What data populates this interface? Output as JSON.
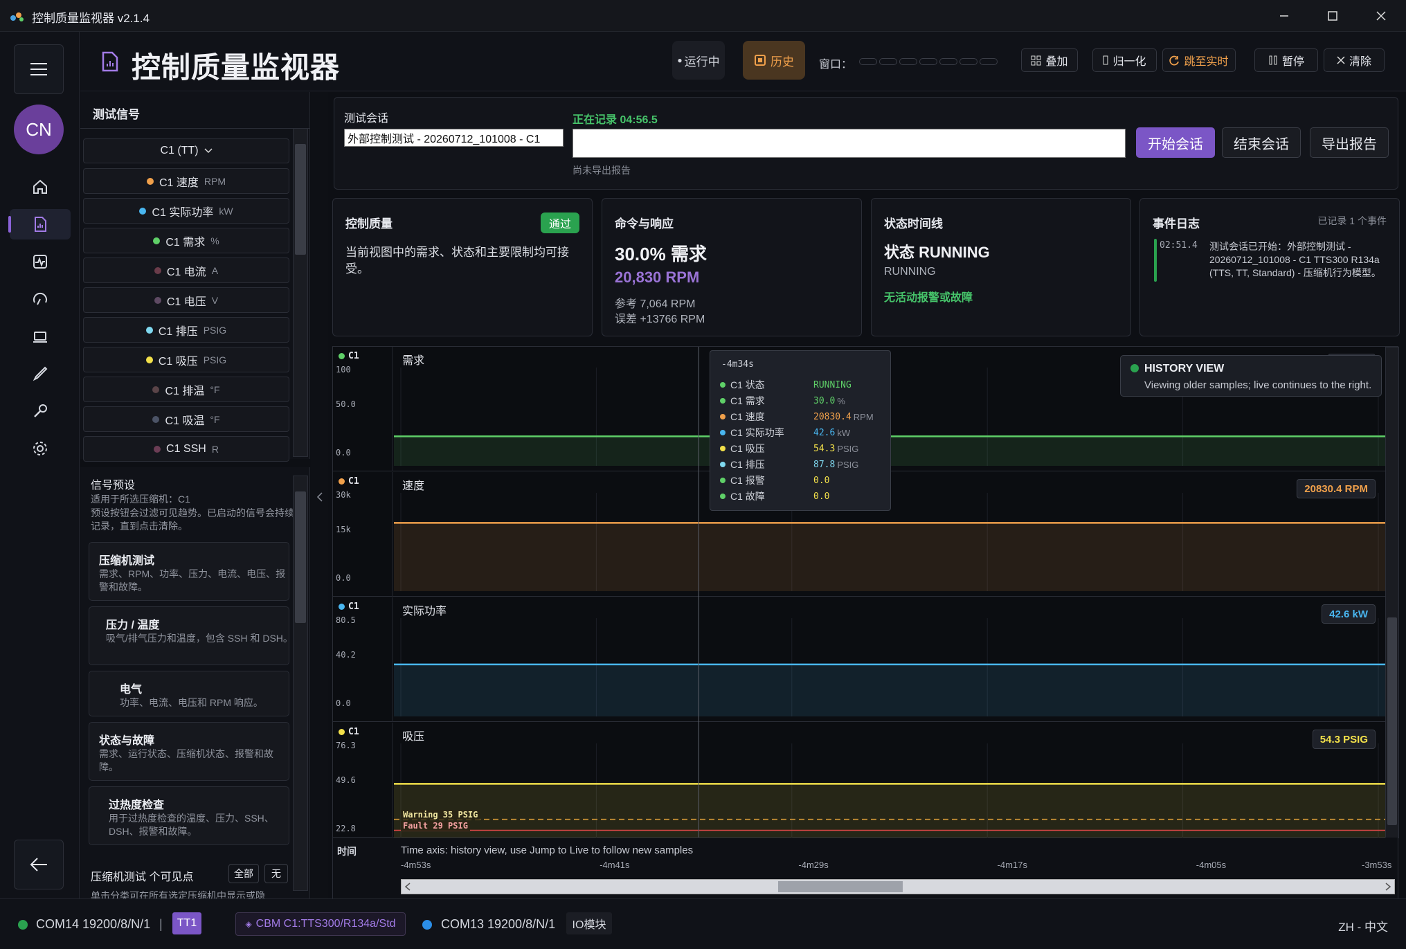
{
  "window": {
    "title": "控制质量监视器 v2.1.4"
  },
  "header": {
    "title": "控制质量监视器",
    "running_label": "运行中",
    "history_label": "历史",
    "window_label": "窗口：",
    "overlay_label": "叠加",
    "normalize_label": "归一化",
    "jump_live_label": "跳至实时",
    "pause_label": "暂停",
    "clear_label": "清除"
  },
  "rail": {
    "avatar_initials": "CN"
  },
  "signals": {
    "title": "测试信号",
    "group": "C1 (TT)",
    "items": [
      {
        "name": "C1 速度",
        "unit": "RPM",
        "color": "#f0a04b"
      },
      {
        "name": "C1 实际功率",
        "unit": "kW",
        "color": "#49b6f0"
      },
      {
        "name": "C1 需求",
        "unit": "%",
        "color": "#5fd068"
      },
      {
        "name": "C1 电流",
        "unit": "A",
        "color": "#6a3c4a"
      },
      {
        "name": "C1 电压",
        "unit": "V",
        "color": "#5e4a63"
      },
      {
        "name": "C1 排压",
        "unit": "PSIG",
        "color": "#7fd8ef"
      },
      {
        "name": "C1 吸压",
        "unit": "PSIG",
        "color": "#f2e04a"
      },
      {
        "name": "C1 排温",
        "unit": "°F",
        "color": "#5a4448"
      },
      {
        "name": "C1 吸温",
        "unit": "°F",
        "color": "#4b5366"
      },
      {
        "name": "C1 SSH",
        "unit": "R",
        "color": "#6b3d55"
      }
    ]
  },
  "presets": {
    "title": "信号预设",
    "applies_to": "适用于所选压缩机：C1",
    "description": "预设按钮会过滤可见趋势。已启动的信号会持续记录，直到点击清除。",
    "cards": [
      {
        "name": "压缩机测试",
        "desc": "需求、RPM、功率、压力、电流、电压、报警和故障。"
      },
      {
        "name": "压力 / 温度",
        "desc": "吸气/排气压力和温度，包含 SSH 和 DSH。"
      },
      {
        "name": "电气",
        "desc": "功率、电流、电压和 RPM 响应。"
      },
      {
        "name": "状态与故障",
        "desc": "需求、运行状态、压缩机状态、报警和故障。"
      },
      {
        "name": "过热度检查",
        "desc": "用于过热度检查的温度、压力、SSH、DSH、报警和故障。"
      }
    ],
    "visible_title": "压缩机测试 个可见点",
    "all_label": "全部",
    "none_label": "无",
    "footer_text": "单击分类可在所有选定压缩机中显示或隐"
  },
  "session": {
    "label": "测试会话",
    "name_value": "外部控制测试 - 20260712_101008 - C1",
    "recording": "正在记录 04:56.5",
    "notes_value": "",
    "export_status": "尚未导出报告",
    "start_label": "开始会话",
    "end_label": "结束会话",
    "export_label": "导出报告"
  },
  "cards": {
    "quality": {
      "title": "控制质量",
      "badge": "通过",
      "text": "当前视图中的需求、状态和主要限制均可接受。"
    },
    "command": {
      "title": "命令与响应",
      "demand": "30.0% 需求",
      "rpm": "20,830 RPM",
      "ref": "参考 7,064 RPM",
      "err": "误差 +13766 RPM"
    },
    "timeline": {
      "title": "状态时间线",
      "state": "状态 RUNNING",
      "sub": "RUNNING",
      "ok": "无活动报警或故障"
    },
    "events": {
      "title": "事件日志",
      "count": "已记录 1 个事件",
      "time": "02:51.4",
      "text": "测试会话已开始：外部控制测试 - 20260712_101008 - C1 TTS300 R134a (TTS, TT, Standard) - 压缩机行为模型。"
    }
  },
  "chart_data": {
    "type": "line",
    "x_range": [
      "-4m53s",
      "-3m53s"
    ],
    "x_ticks": [
      "-4m53s",
      "-4m41s",
      "-4m29s",
      "-4m17s",
      "-4m05s",
      "-3m53s"
    ],
    "cursor_time": "-4m34s",
    "strips": [
      {
        "channel": "C1",
        "title": "需求",
        "color": "#5fd068",
        "ticks": [
          "100",
          "50.0",
          "0.0"
        ],
        "ylim": [
          0,
          100
        ],
        "value": 30.0,
        "tag": "30.0 %"
      },
      {
        "channel": "C1",
        "title": "速度",
        "color": "#f0a04b",
        "ticks": [
          "30k",
          "15k",
          "0.0"
        ],
        "ylim": [
          0,
          30000
        ],
        "value": 20830.4,
        "tag": "20830.4 RPM"
      },
      {
        "channel": "C1",
        "title": "实际功率",
        "color": "#49b6f0",
        "ticks": [
          "80.5",
          "40.2",
          "0.0"
        ],
        "ylim": [
          0,
          80.5
        ],
        "value": 42.6,
        "tag": "42.6 kW"
      },
      {
        "channel": "C1",
        "title": "吸压",
        "color": "#f2e04a",
        "ticks": [
          "76.3",
          "49.6",
          "22.8"
        ],
        "ylim": [
          22.8,
          76.3
        ],
        "value": 54.3,
        "tag": "54.3 PSIG",
        "limits": [
          {
            "label": "Warning 35 PSIG",
            "value": 35,
            "color": "#e0a03a"
          },
          {
            "label": "Fault 29 PSIG",
            "value": 29,
            "color": "#e04848"
          }
        ]
      }
    ],
    "x_axis_label": "时间",
    "x_axis_note": "Time axis: history view, use Jump to Live to follow new samples"
  },
  "tooltip": {
    "time": "-4m34s",
    "rows": [
      {
        "k": "C1 状态",
        "v": "RUNNING",
        "u": "",
        "color": "#5fd068",
        "vcolor": "#5fd068"
      },
      {
        "k": "C1 需求",
        "v": "30.0",
        "u": "%",
        "color": "#5fd068",
        "vcolor": "#5fd068"
      },
      {
        "k": "C1 速度",
        "v": "20830.4",
        "u": "RPM",
        "color": "#f0a04b",
        "vcolor": "#f0a04b"
      },
      {
        "k": "C1 实际功率",
        "v": "42.6",
        "u": "kW",
        "color": "#49b6f0",
        "vcolor": "#49b6f0"
      },
      {
        "k": "C1 吸压",
        "v": "54.3",
        "u": "PSIG",
        "color": "#f2e04a",
        "vcolor": "#f2e04a"
      },
      {
        "k": "C1 排压",
        "v": "87.8",
        "u": "PSIG",
        "color": "#7fd8ef",
        "vcolor": "#7fd8ef"
      },
      {
        "k": "C1 报警",
        "v": "0.0",
        "u": "",
        "color": "#5fd068",
        "vcolor": "#f2e04a"
      },
      {
        "k": "C1 故障",
        "v": "0.0",
        "u": "",
        "color": "#5fd068",
        "vcolor": "#f2e04a"
      }
    ]
  },
  "history_view": {
    "title": "HISTORY VIEW",
    "desc": "Viewing older samples; live continues to the right."
  },
  "statusbar": {
    "port1": "COM14 19200/8/N/1",
    "tt1": "TT1",
    "cbm": "CBM C1:TTS300/R134a/Std",
    "port2": "COM13 19200/8/N/1",
    "io": "IO模块",
    "lang": "ZH - 中文"
  }
}
